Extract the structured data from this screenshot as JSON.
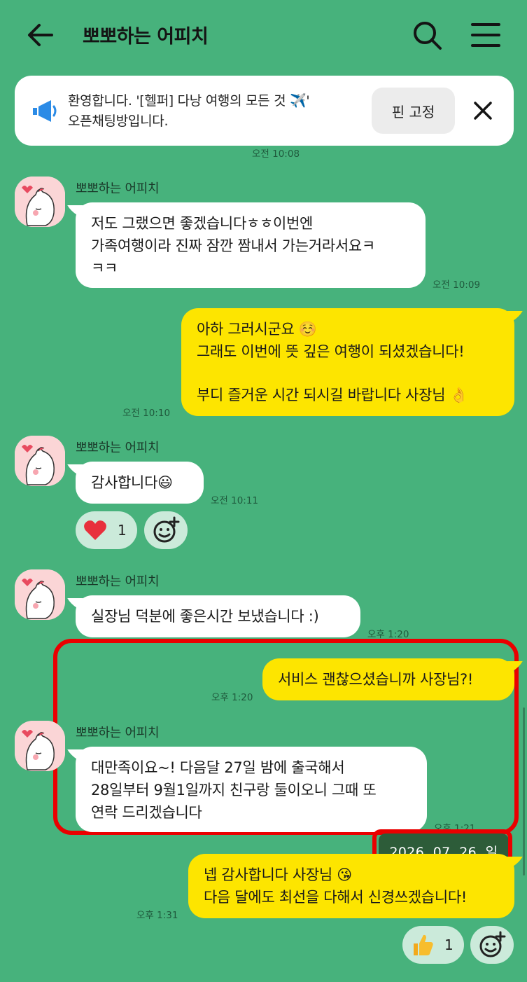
{
  "header": {
    "title": "뽀뽀하는 어피치",
    "back_icon": "arrow-left-icon",
    "search_icon": "search-icon",
    "menu_icon": "hamburger-menu-icon"
  },
  "notice": {
    "line1": "환영합니다. '[헬퍼] 다낭 여행의 모든 것 ✈️'",
    "line2": "오픈채팅방입니다.",
    "pin_label": "핀 고정",
    "icon": "megaphone-icon",
    "close_icon": "close-icon"
  },
  "colors": {
    "background": "#47b27c",
    "my_bubble": "#fde500",
    "their_bubble": "#ffffff",
    "highlight": "#ea0000"
  },
  "messages": [
    {
      "time": "오전 10:08"
    },
    {
      "sender": "뽀뽀하는 어피치",
      "lines": [
        "저도 그랬으면 좋겠습니다ㅎㅎ이번엔",
        "가족여행이라 진짜 잠깐 짬내서 가는거라서요ㅋ",
        "ㅋㅋ"
      ],
      "time": "오전 10:09"
    },
    {
      "lines": [
        "아하 그러시군요 ☺️",
        "그래도 이번에 뜻 깊은 여행이 되셨겠습니다!",
        "",
        "부디 즐거운 시간 되시길 바랍니다 사장님 👌"
      ],
      "time": "오전 10:10"
    },
    {
      "sender": "뽀뽀하는 어피치",
      "lines": [
        "감사합니다😃"
      ],
      "time": "오전 10:11",
      "reaction": {
        "icon": "heart-icon",
        "count": "1"
      }
    },
    {
      "sender": "뽀뽀하는 어피치",
      "lines": [
        "실장님 덕분에 좋은시간 보냈습니다 :)"
      ],
      "time": "오후 1:20"
    },
    {
      "lines": [
        "서비스 괜찮으셨습니까 사장님?!"
      ],
      "time": "오후 1:20"
    },
    {
      "sender": "뽀뽀하는 어피치",
      "lines": [
        "대만족이요~! 다음달 27일 밤에 출국해서",
        "28일부터 9월1일까지 친구랑 둘이오니 그때 또",
        "연락 드리겠습니다"
      ],
      "time": "오후 1:21"
    },
    {
      "lines": [
        "넵 감사합니다 사장님 😘",
        "다음 달에도 최선을 다해서 신경쓰겠습니다!"
      ],
      "time": "오후 1:31",
      "reaction": {
        "icon": "thumbs-up-icon",
        "count": "1"
      }
    }
  ],
  "date_badge": "2026. 07. 26. 일"
}
